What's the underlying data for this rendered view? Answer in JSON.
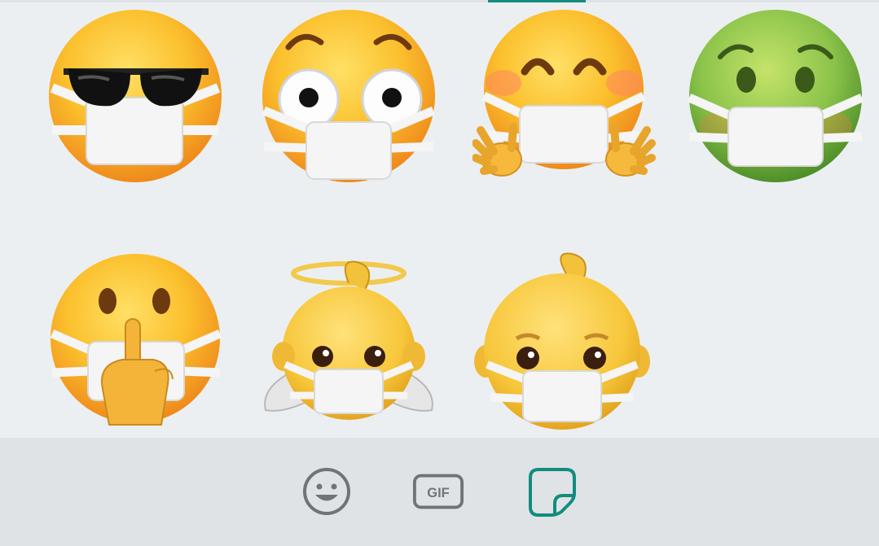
{
  "sticker_pack": {
    "stickers": [
      {
        "icon": "sunglasses-masked-face-sticker"
      },
      {
        "icon": "wide-eyed-masked-face-sticker"
      },
      {
        "icon": "smiling-masked-face-open-hands-sticker"
      },
      {
        "icon": "nauseated-green-masked-face-sticker"
      },
      {
        "icon": "shushing-masked-face-sticker"
      },
      {
        "icon": "angel-baby-masked-face-sticker"
      },
      {
        "icon": "baby-masked-face-sticker"
      }
    ]
  },
  "bottom_bar": {
    "emoji_tab": {
      "icon": "smiley-face-icon",
      "selected": false
    },
    "gif_tab": {
      "label": "GIF",
      "icon": "gif-icon",
      "selected": false
    },
    "sticker_tab": {
      "icon": "sticker-icon",
      "selected": true
    }
  },
  "colors": {
    "accent": "#128c7e",
    "inactive_icon": "#6e757a",
    "panel_bg": "#eceff1",
    "bar_bg": "#dfe3e5"
  }
}
